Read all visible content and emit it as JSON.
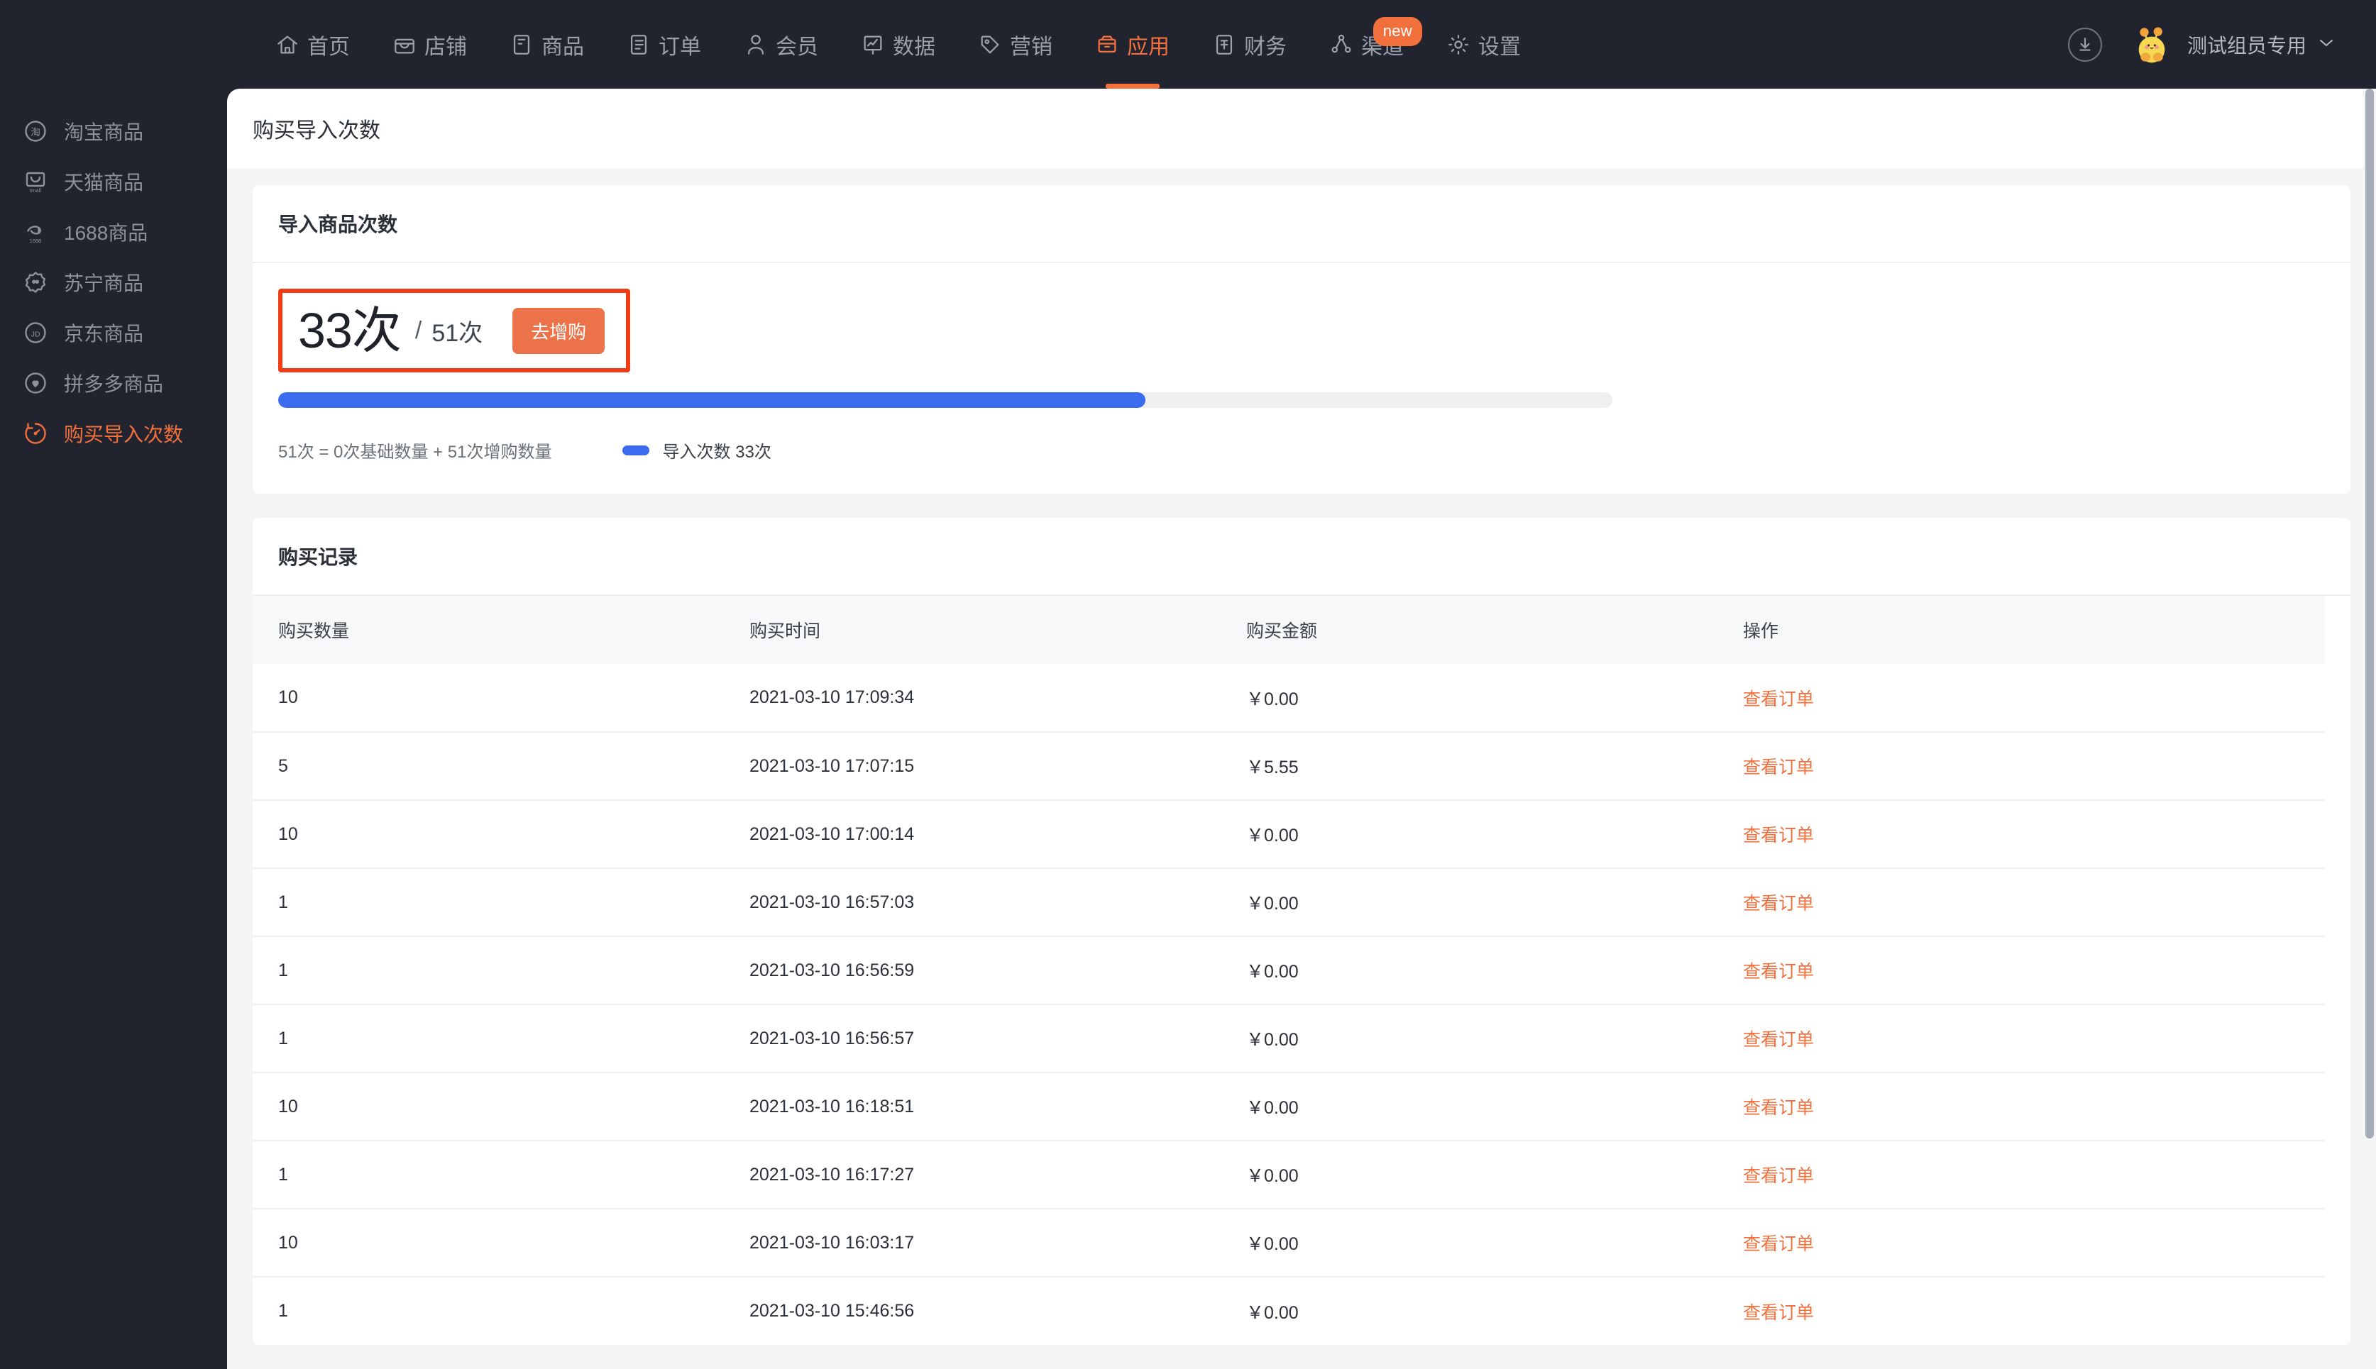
{
  "topnav": {
    "items": [
      {
        "label": "首页",
        "icon": "home-icon",
        "active": false,
        "badge": ""
      },
      {
        "label": "店铺",
        "icon": "shop-icon",
        "active": false,
        "badge": ""
      },
      {
        "label": "商品",
        "icon": "goods-icon",
        "active": false,
        "badge": ""
      },
      {
        "label": "订单",
        "icon": "order-icon",
        "active": false,
        "badge": ""
      },
      {
        "label": "会员",
        "icon": "member-icon",
        "active": false,
        "badge": ""
      },
      {
        "label": "数据",
        "icon": "chart-icon",
        "active": false,
        "badge": ""
      },
      {
        "label": "营销",
        "icon": "tag-icon",
        "active": false,
        "badge": ""
      },
      {
        "label": "应用",
        "icon": "app-box-icon",
        "active": true,
        "badge": ""
      },
      {
        "label": "财务",
        "icon": "finance-icon",
        "active": false,
        "badge": ""
      },
      {
        "label": "渠道",
        "icon": "channel-icon",
        "active": false,
        "badge": "new"
      },
      {
        "label": "设置",
        "icon": "gear-icon",
        "active": false,
        "badge": ""
      }
    ],
    "download_icon": "download-icon",
    "avatar": "avatar-chick",
    "username": "测试组员专用",
    "caret": "chevron-down-icon"
  },
  "sidebar": {
    "items": [
      {
        "label": "淘宝商品",
        "icon": "taobao-icon",
        "active": false
      },
      {
        "label": "天猫商品",
        "icon": "tmall-icon",
        "active": false
      },
      {
        "label": "1688商品",
        "icon": "alibaba-icon",
        "active": false
      },
      {
        "label": "苏宁商品",
        "icon": "suning-icon",
        "active": false
      },
      {
        "label": "京东商品",
        "icon": "jd-icon",
        "active": false
      },
      {
        "label": "拼多多商品",
        "icon": "pdd-icon",
        "active": false
      },
      {
        "label": "购买导入次数",
        "icon": "counter-icon",
        "active": true
      }
    ]
  },
  "page": {
    "title": "购买导入次数"
  },
  "quota_card": {
    "title": "导入商品次数",
    "used": "33次",
    "separator": "/",
    "total": "51次",
    "buy_button": "去增购",
    "breakdown": "51次 = 0次基础数量 + 51次增购数量",
    "legend_label": "导入次数 33次",
    "progress_percent": 65,
    "colors": {
      "bar": "#3b6cf0",
      "track": "#efeff0",
      "highlight": "#f03d16",
      "button": "#ec7249"
    }
  },
  "record_card": {
    "title": "购买记录",
    "columns": [
      "购买数量",
      "购买时间",
      "购买金额",
      "操作"
    ],
    "action_label": "查看订单",
    "rows": [
      {
        "qty": "10",
        "time": "2021-03-10 17:09:34",
        "amount": "￥0.00",
        "action": "查看订单"
      },
      {
        "qty": "5",
        "time": "2021-03-10 17:07:15",
        "amount": "￥5.55",
        "action": "查看订单"
      },
      {
        "qty": "10",
        "time": "2021-03-10 17:00:14",
        "amount": "￥0.00",
        "action": "查看订单"
      },
      {
        "qty": "1",
        "time": "2021-03-10 16:57:03",
        "amount": "￥0.00",
        "action": "查看订单"
      },
      {
        "qty": "1",
        "time": "2021-03-10 16:56:59",
        "amount": "￥0.00",
        "action": "查看订单"
      },
      {
        "qty": "1",
        "time": "2021-03-10 16:56:57",
        "amount": "￥0.00",
        "action": "查看订单"
      },
      {
        "qty": "10",
        "time": "2021-03-10 16:18:51",
        "amount": "￥0.00",
        "action": "查看订单"
      },
      {
        "qty": "1",
        "time": "2021-03-10 16:17:27",
        "amount": "￥0.00",
        "action": "查看订单"
      },
      {
        "qty": "10",
        "time": "2021-03-10 16:03:17",
        "amount": "￥0.00",
        "action": "查看订单"
      },
      {
        "qty": "1",
        "time": "2021-03-10 15:46:56",
        "amount": "￥0.00",
        "action": "查看订单"
      }
    ]
  }
}
